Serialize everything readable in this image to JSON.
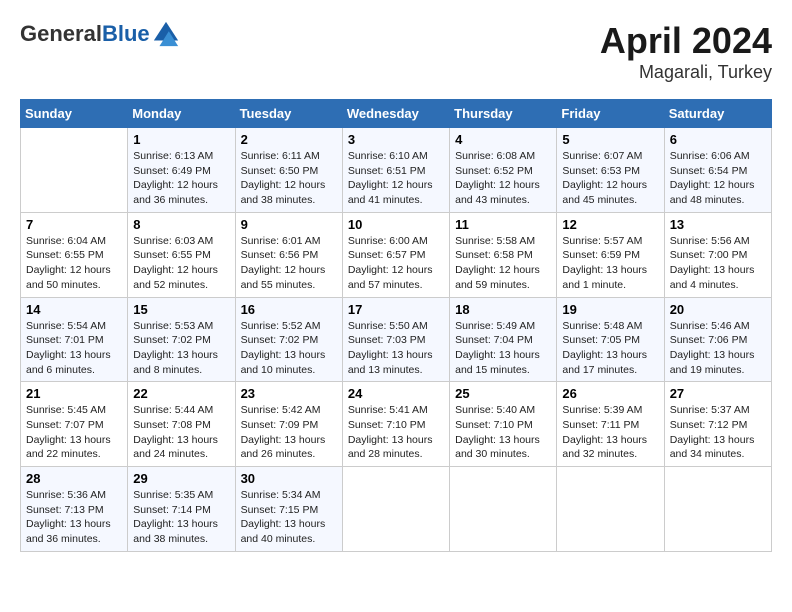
{
  "header": {
    "logo_general": "General",
    "logo_blue": "Blue",
    "month": "April 2024",
    "location": "Magarali, Turkey"
  },
  "days_of_week": [
    "Sunday",
    "Monday",
    "Tuesday",
    "Wednesday",
    "Thursday",
    "Friday",
    "Saturday"
  ],
  "weeks": [
    [
      {
        "day": "",
        "sunrise": "",
        "sunset": "",
        "daylight": ""
      },
      {
        "day": "1",
        "sunrise": "Sunrise: 6:13 AM",
        "sunset": "Sunset: 6:49 PM",
        "daylight": "Daylight: 12 hours and 36 minutes."
      },
      {
        "day": "2",
        "sunrise": "Sunrise: 6:11 AM",
        "sunset": "Sunset: 6:50 PM",
        "daylight": "Daylight: 12 hours and 38 minutes."
      },
      {
        "day": "3",
        "sunrise": "Sunrise: 6:10 AM",
        "sunset": "Sunset: 6:51 PM",
        "daylight": "Daylight: 12 hours and 41 minutes."
      },
      {
        "day": "4",
        "sunrise": "Sunrise: 6:08 AM",
        "sunset": "Sunset: 6:52 PM",
        "daylight": "Daylight: 12 hours and 43 minutes."
      },
      {
        "day": "5",
        "sunrise": "Sunrise: 6:07 AM",
        "sunset": "Sunset: 6:53 PM",
        "daylight": "Daylight: 12 hours and 45 minutes."
      },
      {
        "day": "6",
        "sunrise": "Sunrise: 6:06 AM",
        "sunset": "Sunset: 6:54 PM",
        "daylight": "Daylight: 12 hours and 48 minutes."
      }
    ],
    [
      {
        "day": "7",
        "sunrise": "Sunrise: 6:04 AM",
        "sunset": "Sunset: 6:55 PM",
        "daylight": "Daylight: 12 hours and 50 minutes."
      },
      {
        "day": "8",
        "sunrise": "Sunrise: 6:03 AM",
        "sunset": "Sunset: 6:55 PM",
        "daylight": "Daylight: 12 hours and 52 minutes."
      },
      {
        "day": "9",
        "sunrise": "Sunrise: 6:01 AM",
        "sunset": "Sunset: 6:56 PM",
        "daylight": "Daylight: 12 hours and 55 minutes."
      },
      {
        "day": "10",
        "sunrise": "Sunrise: 6:00 AM",
        "sunset": "Sunset: 6:57 PM",
        "daylight": "Daylight: 12 hours and 57 minutes."
      },
      {
        "day": "11",
        "sunrise": "Sunrise: 5:58 AM",
        "sunset": "Sunset: 6:58 PM",
        "daylight": "Daylight: 12 hours and 59 minutes."
      },
      {
        "day": "12",
        "sunrise": "Sunrise: 5:57 AM",
        "sunset": "Sunset: 6:59 PM",
        "daylight": "Daylight: 13 hours and 1 minute."
      },
      {
        "day": "13",
        "sunrise": "Sunrise: 5:56 AM",
        "sunset": "Sunset: 7:00 PM",
        "daylight": "Daylight: 13 hours and 4 minutes."
      }
    ],
    [
      {
        "day": "14",
        "sunrise": "Sunrise: 5:54 AM",
        "sunset": "Sunset: 7:01 PM",
        "daylight": "Daylight: 13 hours and 6 minutes."
      },
      {
        "day": "15",
        "sunrise": "Sunrise: 5:53 AM",
        "sunset": "Sunset: 7:02 PM",
        "daylight": "Daylight: 13 hours and 8 minutes."
      },
      {
        "day": "16",
        "sunrise": "Sunrise: 5:52 AM",
        "sunset": "Sunset: 7:02 PM",
        "daylight": "Daylight: 13 hours and 10 minutes."
      },
      {
        "day": "17",
        "sunrise": "Sunrise: 5:50 AM",
        "sunset": "Sunset: 7:03 PM",
        "daylight": "Daylight: 13 hours and 13 minutes."
      },
      {
        "day": "18",
        "sunrise": "Sunrise: 5:49 AM",
        "sunset": "Sunset: 7:04 PM",
        "daylight": "Daylight: 13 hours and 15 minutes."
      },
      {
        "day": "19",
        "sunrise": "Sunrise: 5:48 AM",
        "sunset": "Sunset: 7:05 PM",
        "daylight": "Daylight: 13 hours and 17 minutes."
      },
      {
        "day": "20",
        "sunrise": "Sunrise: 5:46 AM",
        "sunset": "Sunset: 7:06 PM",
        "daylight": "Daylight: 13 hours and 19 minutes."
      }
    ],
    [
      {
        "day": "21",
        "sunrise": "Sunrise: 5:45 AM",
        "sunset": "Sunset: 7:07 PM",
        "daylight": "Daylight: 13 hours and 22 minutes."
      },
      {
        "day": "22",
        "sunrise": "Sunrise: 5:44 AM",
        "sunset": "Sunset: 7:08 PM",
        "daylight": "Daylight: 13 hours and 24 minutes."
      },
      {
        "day": "23",
        "sunrise": "Sunrise: 5:42 AM",
        "sunset": "Sunset: 7:09 PM",
        "daylight": "Daylight: 13 hours and 26 minutes."
      },
      {
        "day": "24",
        "sunrise": "Sunrise: 5:41 AM",
        "sunset": "Sunset: 7:10 PM",
        "daylight": "Daylight: 13 hours and 28 minutes."
      },
      {
        "day": "25",
        "sunrise": "Sunrise: 5:40 AM",
        "sunset": "Sunset: 7:10 PM",
        "daylight": "Daylight: 13 hours and 30 minutes."
      },
      {
        "day": "26",
        "sunrise": "Sunrise: 5:39 AM",
        "sunset": "Sunset: 7:11 PM",
        "daylight": "Daylight: 13 hours and 32 minutes."
      },
      {
        "day": "27",
        "sunrise": "Sunrise: 5:37 AM",
        "sunset": "Sunset: 7:12 PM",
        "daylight": "Daylight: 13 hours and 34 minutes."
      }
    ],
    [
      {
        "day": "28",
        "sunrise": "Sunrise: 5:36 AM",
        "sunset": "Sunset: 7:13 PM",
        "daylight": "Daylight: 13 hours and 36 minutes."
      },
      {
        "day": "29",
        "sunrise": "Sunrise: 5:35 AM",
        "sunset": "Sunset: 7:14 PM",
        "daylight": "Daylight: 13 hours and 38 minutes."
      },
      {
        "day": "30",
        "sunrise": "Sunrise: 5:34 AM",
        "sunset": "Sunset: 7:15 PM",
        "daylight": "Daylight: 13 hours and 40 minutes."
      },
      {
        "day": "",
        "sunrise": "",
        "sunset": "",
        "daylight": ""
      },
      {
        "day": "",
        "sunrise": "",
        "sunset": "",
        "daylight": ""
      },
      {
        "day": "",
        "sunrise": "",
        "sunset": "",
        "daylight": ""
      },
      {
        "day": "",
        "sunrise": "",
        "sunset": "",
        "daylight": ""
      }
    ]
  ]
}
